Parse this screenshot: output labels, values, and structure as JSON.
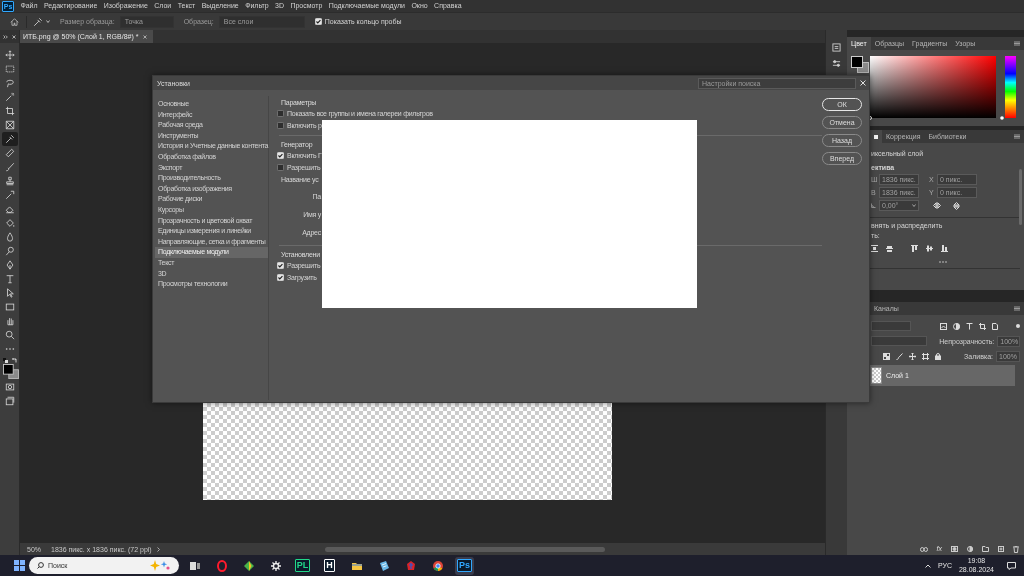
{
  "menu_bar": {
    "logo": "Ps",
    "items": [
      "Файл",
      "Редактирование",
      "Изображение",
      "Слои",
      "Текст",
      "Выделение",
      "Фильтр",
      "3D",
      "Просмотр",
      "Подключаемые модули",
      "Окно",
      "Справка"
    ]
  },
  "options_bar": {
    "fields": [
      {
        "label": "Размер образца:",
        "value": "Точка",
        "disabled": true
      },
      {
        "label": "Образец:",
        "value": "Все слои",
        "disabled": true
      }
    ],
    "checkbox": {
      "label": "Показать кольцо пробы",
      "checked": true
    }
  },
  "toolbar": {
    "tools": [
      {
        "kind": "move",
        "selected": false
      },
      {
        "kind": "marquee",
        "selected": false
      },
      {
        "kind": "lasso",
        "selected": false
      },
      {
        "kind": "wand",
        "selected": false
      },
      {
        "kind": "crop",
        "selected": false
      },
      {
        "kind": "frame",
        "selected": false
      },
      {
        "kind": "eyedropper",
        "selected": true
      },
      {
        "kind": "heal",
        "selected": false
      },
      {
        "kind": "brush",
        "selected": false
      },
      {
        "kind": "stamp",
        "selected": false
      },
      {
        "kind": "history",
        "selected": false
      },
      {
        "kind": "eraser",
        "selected": false
      },
      {
        "kind": "bucket",
        "selected": false
      },
      {
        "kind": "blur",
        "selected": false
      },
      {
        "kind": "dodge",
        "selected": false
      },
      {
        "kind": "pen",
        "selected": false
      },
      {
        "kind": "type",
        "selected": false
      },
      {
        "kind": "select",
        "selected": false
      },
      {
        "kind": "rect",
        "selected": false
      },
      {
        "kind": "hand",
        "selected": false
      },
      {
        "kind": "zoom",
        "selected": false
      },
      {
        "kind": "more",
        "selected": false
      },
      {
        "kind": "colors",
        "selected": false
      },
      {
        "kind": "mask",
        "selected": false
      },
      {
        "kind": "screen",
        "selected": false
      }
    ]
  },
  "document": {
    "tab": "ИТБ.png @ 50% (Слой 1, RGB/8#) *"
  },
  "status_bar": {
    "zoom": "50%",
    "size": "1836 пикс. x 1836 пикс. (72 ppi)"
  },
  "color_panel": {
    "tabs": [
      {
        "label": "Цвет",
        "selected": true
      },
      {
        "label": "Образцы",
        "selected": false
      },
      {
        "label": "Градиенты",
        "selected": false
      },
      {
        "label": "Узоры",
        "selected": false
      }
    ],
    "hue_slider": {
      "level": 0
    }
  },
  "properties_panel": {
    "tabs": [
      {
        "kind": "icon",
        "selected": true
      },
      {
        "kind": "text",
        "label": "Коррекция",
        "selected": false
      },
      {
        "kind": "text",
        "label": "Библиотеки",
        "selected": false
      }
    ],
    "layer_type": "иксельный слой",
    "transform_heading": "ектива",
    "fields": [
      {
        "label": "Ш",
        "value": "1836 пикс."
      },
      {
        "label": "X",
        "value": "0 пикс."
      },
      {
        "label": "В",
        "value": "1836 пикс."
      },
      {
        "label": "Y",
        "value": "0 пикс."
      }
    ],
    "angle": "0,00°",
    "align_heading": "внять и распределить",
    "align_label": "ть:"
  },
  "layers_panel": {
    "tabs": [
      {
        "label": "Каналы",
        "selected": false
      }
    ],
    "opacity": {
      "label": "Непрозрачность:",
      "value": "100%"
    },
    "fill": {
      "label": "Заливка:",
      "value": "100%"
    },
    "layers": [
      {
        "name": "Слой 1",
        "selected": true
      }
    ],
    "effects_button": "fx"
  },
  "dialog": {
    "title": "Установки",
    "search": {
      "placeholder": "Настройки поиска"
    },
    "categories": [
      {
        "label": "Основные",
        "selected": false
      },
      {
        "label": "Интерфейс",
        "selected": false
      },
      {
        "label": "Рабочая среда",
        "selected": false
      },
      {
        "label": "Инструменты",
        "selected": false
      },
      {
        "label": "История и Учетные данные контента",
        "selected": false
      },
      {
        "label": "Обработка файлов",
        "selected": false
      },
      {
        "label": "Экспорт",
        "selected": false
      },
      {
        "label": "Производительность",
        "selected": false
      },
      {
        "label": "Обработка изображения",
        "selected": false
      },
      {
        "label": "Рабочие диски",
        "selected": false
      },
      {
        "label": "Курсоры",
        "selected": false
      },
      {
        "label": "Прозрачность и цветовой охват",
        "selected": false
      },
      {
        "label": "Единицы измерения и линейки",
        "selected": false
      },
      {
        "label": "Направляющие, сетка и фрагменты",
        "selected": false
      },
      {
        "label": "Подключаемые модули",
        "selected": true
      },
      {
        "label": "Текст",
        "selected": false
      },
      {
        "label": "3D",
        "selected": false
      },
      {
        "label": "Просмотры технологии",
        "selected": false
      }
    ],
    "sections": [
      {
        "heading": "Параметры",
        "rows": [
          {
            "kind": "checkbox",
            "label": "Показать все группы и имена галереи фильтров",
            "checked": false
          },
          {
            "kind": "checkbox",
            "label": "Включить р",
            "checked": false
          }
        ]
      },
      {
        "heading": "Генератор",
        "rows": [
          {
            "kind": "checkbox",
            "label": "Включить Г",
            "checked": true
          },
          {
            "kind": "checkbox",
            "label": "Разрешить",
            "checked": false
          },
          {
            "kind": "label",
            "label": "Название ус"
          },
          {
            "kind": "field-label",
            "label": "Па"
          },
          {
            "kind": "field-label",
            "label": "Имя у"
          },
          {
            "kind": "field-label",
            "label": "Адрес"
          }
        ]
      },
      {
        "heading": "Установлени",
        "rows": [
          {
            "kind": "checkbox",
            "label": "Разрешить",
            "checked": true
          },
          {
            "kind": "checkbox",
            "label": "Загрузить",
            "checked": true
          }
        ]
      }
    ],
    "buttons": [
      {
        "label": "ОК",
        "default": true
      },
      {
        "label": "Отмена",
        "default": false
      },
      {
        "label": "Назад",
        "default": false
      },
      {
        "label": "Вперед",
        "default": false
      }
    ]
  },
  "taskbar": {
    "search": {
      "placeholder": "Поиск"
    },
    "apps": [
      {
        "kind": "taskview",
        "selected": false
      },
      {
        "kind": "ring",
        "selected": false
      },
      {
        "kind": "gem",
        "selected": false
      },
      {
        "kind": "gear",
        "selected": false
      },
      {
        "kind": "text",
        "label": "PL",
        "color": "#21d789",
        "selected": false
      },
      {
        "kind": "text",
        "label": "H",
        "color": "#ffffff",
        "selected": false
      },
      {
        "kind": "folder",
        "selected": false
      },
      {
        "kind": "note",
        "selected": false
      },
      {
        "kind": "emblem",
        "selected": false
      },
      {
        "kind": "browser",
        "selected": false
      },
      {
        "kind": "text",
        "label": "Ps",
        "color": "#31a8ff",
        "selected": true
      }
    ],
    "language": "РУС",
    "time": "19:08",
    "date": "28.08.2024"
  }
}
